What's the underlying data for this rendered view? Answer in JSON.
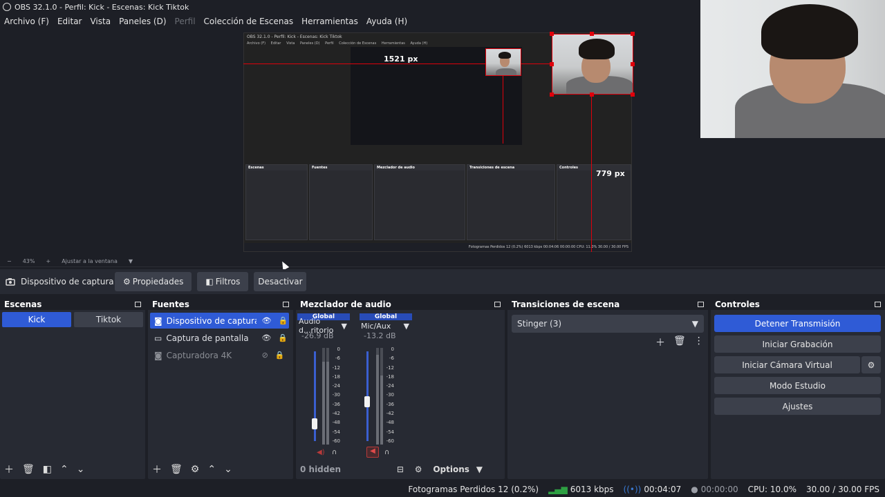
{
  "window": {
    "title": "OBS 32.1.0 - Perfil: Kick - Escenas: Kick Tiktok"
  },
  "menu": [
    "Archivo (F)",
    "Editar",
    "Vista",
    "Paneles (D)",
    "Perfil",
    "Colección de Escenas",
    "Herramientas",
    "Ayuda (H)"
  ],
  "preview": {
    "nested_title": "OBS 32.1.0 - Perfil: Kick - Escenas: Kick Tiktok",
    "nested_menu": [
      "Archivo (F)",
      "Editar",
      "Vista",
      "Paneles (D)",
      "Perfil",
      "Colección de Escenas",
      "Herramientas",
      "Ayuda (H)"
    ],
    "label_width": "1521 px",
    "label_height": "779 px",
    "nested_panels": [
      "Escenas",
      "Fuentes",
      "Mezclador de audio",
      "Transiciones de escena",
      "Controles"
    ],
    "nested_status": "Fotogramas Perdidos 12 (0.2%)  6013 kbps  00:04:06  00:00:00  CPU: 11.0%  30.00 / 30.00 FPS"
  },
  "zoom": {
    "minus": "−",
    "value": "43%",
    "plus": "+",
    "fit": "Ajustar a la ventana",
    "chevron": "▼"
  },
  "source_bar": {
    "icon": "camera-icon",
    "label": "Dispositivo de captura de v",
    "properties": "Propiedades",
    "filters": "Filtros",
    "deactivate": "Desactivar"
  },
  "scenes": {
    "title": "Escenas",
    "items": [
      "Kick",
      "Tiktok"
    ],
    "active": "Kick"
  },
  "sources": {
    "title": "Fuentes",
    "items": [
      {
        "name": "Dispositivo de captura de",
        "icon": "camera-icon",
        "visible": true
      },
      {
        "name": "Captura de pantalla",
        "icon": "monitor-icon",
        "visible": true
      },
      {
        "name": "Capturadora 4K",
        "icon": "camera-icon",
        "visible": false
      }
    ]
  },
  "mixer": {
    "title": "Mezclador de audio",
    "channels": [
      {
        "global": "Global",
        "name": "Audio d...ritorio",
        "db": "-26.9 dB",
        "muted": false
      },
      {
        "global": "Global",
        "name": "Mic/Aux",
        "db": "-13.2 dB",
        "muted": true
      }
    ],
    "scale": [
      "0",
      "-6",
      "-12",
      "-18",
      "-24",
      "-30",
      "-36",
      "-42",
      "-48",
      "-54",
      "-60"
    ],
    "hidden": "0 hidden",
    "options": "Options"
  },
  "transitions": {
    "title": "Transiciones de escena",
    "selected": "Stinger (3)"
  },
  "controls": {
    "title": "Controles",
    "stop_stream": "Detener Transmisión",
    "start_recording": "Iniciar Grabación",
    "virtual_cam": "Iniciar Cámara Virtual",
    "studio_mode": "Modo Estudio",
    "settings": "Ajustes"
  },
  "status": {
    "dropped": "Fotogramas Perdidos 12 (0.2%)",
    "bitrate": "6013 kbps",
    "stream_time": "00:04:07",
    "rec_time": "00:00:00",
    "cpu": "CPU: 10.0%",
    "fps": "30.00 / 30.00 FPS"
  },
  "colors": {
    "accent": "#284cb8",
    "selected": "#2f5bd6",
    "guide": "#e0000b",
    "panel": "#272a33",
    "bg": "#1d1f26"
  }
}
